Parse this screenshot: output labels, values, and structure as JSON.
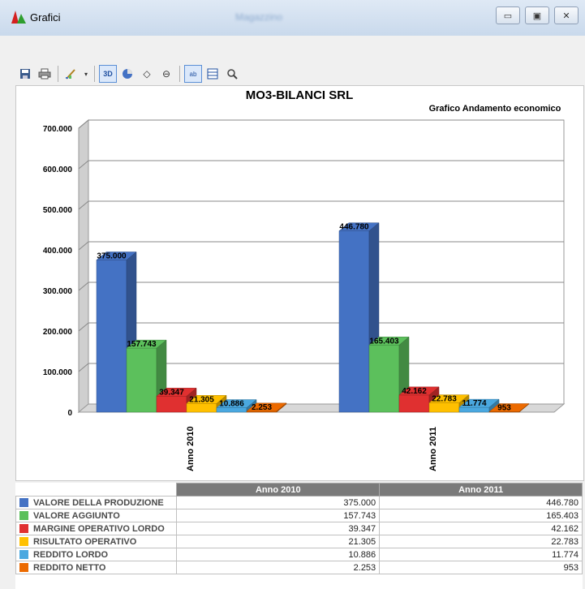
{
  "window": {
    "title": "Grafici",
    "blurred_title": "Magazzino",
    "buttons": [
      "minimize",
      "restore",
      "close"
    ]
  },
  "toolbar": {
    "icons": [
      "save-icon",
      "print-icon",
      "chart-wizard-icon",
      "3d-icon",
      "pie-icon",
      "rotate-horizontal-icon",
      "rotate-vertical-icon",
      "data-labels-icon",
      "data-table-icon",
      "zoom-icon"
    ]
  },
  "chart_data": {
    "type": "bar",
    "title": "MO3-BILANCI SRL",
    "subtitle": "Grafico Andamento economico",
    "categories": [
      "Anno 2010",
      "Anno 2011"
    ],
    "ylim": [
      0,
      700000
    ],
    "yticks": [
      "0",
      "100.000",
      "200.000",
      "300.000",
      "400.000",
      "500.000",
      "600.000",
      "700.000"
    ],
    "grid": true,
    "three_d": true,
    "series": [
      {
        "name": "VALORE DELLA PRODUZIONE",
        "color": "#4472c4",
        "values": [
          375000,
          446780
        ],
        "labels": [
          "375.000",
          "446.780"
        ]
      },
      {
        "name": "VALORE AGGIUNTO",
        "color": "#5cc05c",
        "values": [
          157743,
          165403
        ],
        "labels": [
          "157.743",
          "165.403"
        ]
      },
      {
        "name": "MARGINE OPERATIVO LORDO",
        "color": "#e03030",
        "values": [
          39347,
          42162
        ],
        "labels": [
          "39.347",
          "42.162"
        ]
      },
      {
        "name": "RISULTATO OPERATIVO",
        "color": "#ffc000",
        "values": [
          21305,
          22783
        ],
        "labels": [
          "21.305",
          "22.783"
        ]
      },
      {
        "name": "REDDITO LORDO",
        "color": "#4aa8e0",
        "values": [
          10886,
          11774
        ],
        "labels": [
          "10.886",
          "11.774"
        ]
      },
      {
        "name": "REDDITO NETTO",
        "color": "#ec6a00",
        "values": [
          2253,
          953
        ],
        "labels": [
          "2.253",
          "953"
        ]
      }
    ]
  }
}
